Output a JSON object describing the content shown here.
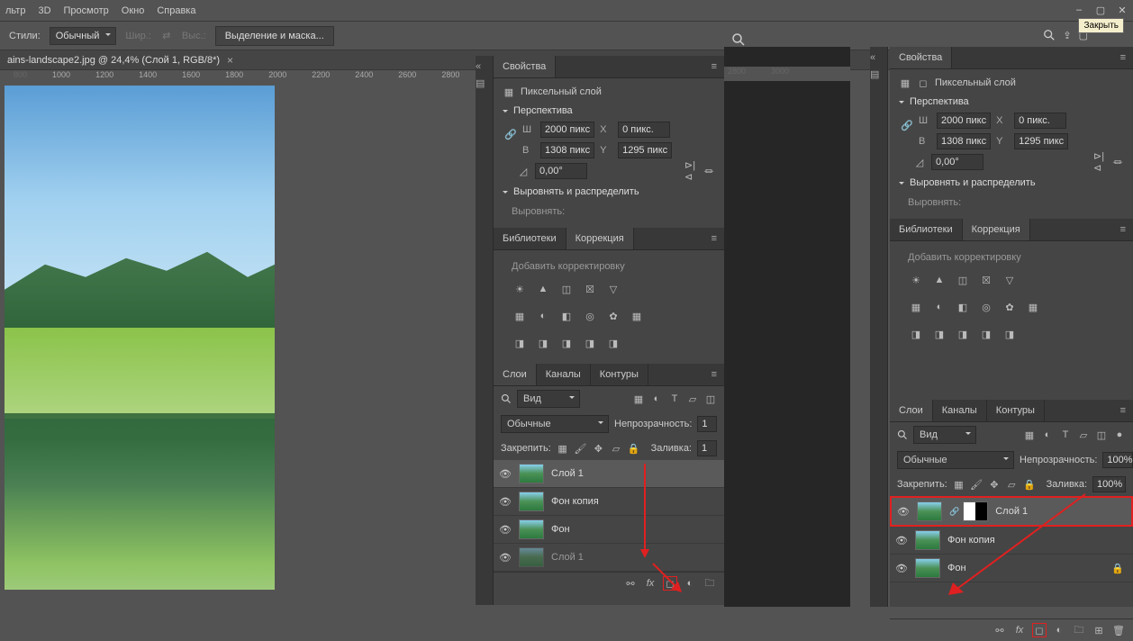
{
  "menubar": {
    "items": [
      "льтр",
      "3D",
      "Просмотр",
      "Окно",
      "Справка"
    ]
  },
  "window_controls": {
    "tooltip": "Закрыть"
  },
  "optionsbar": {
    "styles_label": "Стили:",
    "style_value": "Обычный",
    "width_label": "Шир.:",
    "height_label": "Выс.:",
    "select_mask_btn": "Выделение и маска..."
  },
  "document": {
    "tab_title": "ains-landscape2.jpg @ 24,4% (Слой 1, RGB/8*)"
  },
  "ruler_marks": [
    "800",
    "1000",
    "1200",
    "1400",
    "1600",
    "1800",
    "2000",
    "2200",
    "2400",
    "2600",
    "2800"
  ],
  "ruler_marks_gap": [
    "2800",
    "3000"
  ],
  "properties_left": {
    "title": "Свойства",
    "layer_type": "Пиксельный слой",
    "transform_section": "Перспектива",
    "w_label": "Ш",
    "w_value": "2000 пикс",
    "h_label": "В",
    "h_value": "1308 пикс",
    "x_label": "X",
    "x_value": "0 пикс.",
    "y_label": "Y",
    "y_value": "1295 пикс",
    "angle_value": "0,00°",
    "align_section": "Выровнять и распределить",
    "align_label": "Выровнять:"
  },
  "properties_right": {
    "title": "Свойства",
    "layer_type": "Пиксельный слой",
    "transform_section": "Перспектива",
    "w_label": "Ш",
    "w_value": "2000 пикс",
    "h_label": "В",
    "h_value": "1308 пикс",
    "x_label": "X",
    "x_value": "0 пикс.",
    "y_label": "Y",
    "y_value": "1295 пикс",
    "angle_value": "0,00°",
    "align_section": "Выровнять и распределить",
    "align_label": "Выровнять:"
  },
  "libraries_tabs": {
    "lib": "Библиотеки",
    "corr": "Коррекция",
    "add_label": "Добавить корректировку"
  },
  "layers_panel_left": {
    "tabs": [
      "Слои",
      "Каналы",
      "Контуры"
    ],
    "filter_label": "Вид",
    "blend_value": "Обычные",
    "opacity_label": "Непрозрачность:",
    "opacity_value": "1",
    "lock_label": "Закрепить:",
    "fill_label": "Заливка:",
    "fill_value": "1",
    "layers": [
      {
        "name": "Слой 1",
        "visible": true,
        "selected": true
      },
      {
        "name": "Фон копия",
        "visible": true,
        "selected": false
      },
      {
        "name": "Фон",
        "visible": true,
        "selected": false
      },
      {
        "name": "Слой 1",
        "visible": true,
        "selected": false,
        "faded": true
      }
    ]
  },
  "layers_panel_right": {
    "tabs": [
      "Слои",
      "Каналы",
      "Контуры"
    ],
    "filter_label": "Вид",
    "blend_value": "Обычные",
    "opacity_label": "Непрозрачность:",
    "opacity_value": "100%",
    "lock_label": "Закрепить:",
    "fill_label": "Заливка:",
    "fill_value": "100%",
    "layers": [
      {
        "name": "Слой 1",
        "visible": true,
        "selected": true,
        "highlighted": true,
        "has_mask": true
      },
      {
        "name": "Фон копия",
        "visible": true,
        "selected": false
      },
      {
        "name": "Фон",
        "visible": true,
        "selected": false,
        "locked": true
      }
    ]
  }
}
